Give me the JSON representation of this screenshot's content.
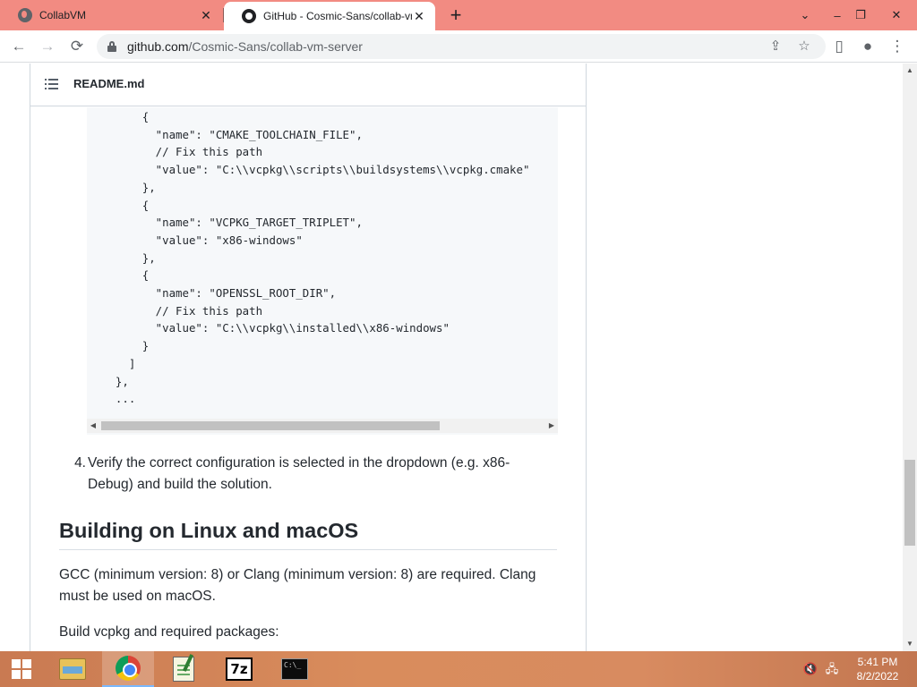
{
  "browser": {
    "tabs": [
      {
        "title": "CollabVM",
        "icon": "globe-icon",
        "active": false
      },
      {
        "title": "GitHub - Cosmic-Sans/collab-vm",
        "icon": "github-icon",
        "active": true
      }
    ],
    "new_tab_label": "+",
    "window_controls": {
      "tab_search": "⌄",
      "minimize": "–",
      "restore": "❐",
      "close": "✕"
    },
    "nav": {
      "back": "←",
      "forward": "→",
      "reload": "⟳"
    },
    "url": {
      "host": "github.com",
      "path": "/Cosmic-Sans/collab-vm-server"
    },
    "omnibox_icons": {
      "share": "⇪",
      "bookmark": "☆"
    },
    "toolbar_icons": {
      "side_panel": "▯",
      "profile": "●",
      "menu": "⋮"
    }
  },
  "readme": {
    "title": "README.md",
    "code_lines": [
      "      {",
      "        \"name\": \"CMAKE_TOOLCHAIN_FILE\",",
      "        // Fix this path",
      "        \"value\": \"C:\\\\vcpkg\\\\scripts\\\\buildsystems\\\\vcpkg.cmake\"",
      "      },",
      "      {",
      "        \"name\": \"VCPKG_TARGET_TRIPLET\",",
      "        \"value\": \"x86-windows\"",
      "      },",
      "      {",
      "        \"name\": \"OPENSSL_ROOT_DIR\",",
      "        // Fix this path",
      "        \"value\": \"C:\\\\vcpkg\\\\installed\\\\x86-windows\"",
      "      }",
      "    ]",
      "  },",
      "  ..."
    ],
    "step_number": "4.",
    "step_text": "Verify the correct configuration is selected in the dropdown (e.g. x86-Debug) and build the solution.",
    "heading": "Building on Linux and macOS",
    "paragraph1": "GCC (minimum version: 8) or Clang (minimum version: 8) are required. Clang must be used on macOS.",
    "paragraph2": "Build vcpkg and required packages:"
  },
  "taskbar": {
    "apps": [
      "file-explorer",
      "google-chrome",
      "notepad-plus-plus",
      "7-zip",
      "command-prompt"
    ],
    "sevenzip_label": "7z",
    "cmd_label": "C:\\_",
    "tray": {
      "volume": "🔇",
      "network": "🖧"
    },
    "time": "5:41 PM",
    "date": "8/2/2022"
  }
}
